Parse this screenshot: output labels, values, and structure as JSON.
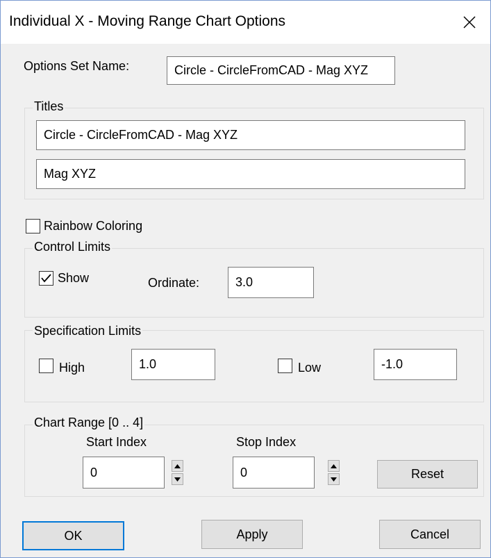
{
  "window": {
    "title": "Individual X - Moving Range Chart Options"
  },
  "options_set": {
    "label": "Options Set Name:",
    "value": "Circle - CircleFromCAD - Mag XYZ"
  },
  "titles": {
    "group_label": "Titles",
    "title1": "Circle - CircleFromCAD - Mag XYZ",
    "title2": "Mag XYZ"
  },
  "rainbow": {
    "label": "Rainbow Coloring",
    "checked": false
  },
  "control_limits": {
    "group_label": "Control Limits",
    "show_label": "Show",
    "show_checked": true,
    "ordinate_label": "Ordinate:",
    "ordinate_value": "3.0"
  },
  "spec_limits": {
    "group_label": "Specification Limits",
    "high_label": "High",
    "high_checked": false,
    "high_value": "1.0",
    "low_label": "Low",
    "low_checked": false,
    "low_value": "-1.0"
  },
  "chart_range": {
    "group_label": "Chart Range [0 .. 4]",
    "start_label": "Start Index",
    "start_value": "0",
    "stop_label": "Stop Index",
    "stop_value": "0",
    "reset_label": "Reset"
  },
  "buttons": {
    "ok": "OK",
    "apply": "Apply",
    "cancel": "Cancel"
  },
  "colors": {
    "accent": "#0078d7",
    "dialog_bg": "#f0f0f0"
  }
}
